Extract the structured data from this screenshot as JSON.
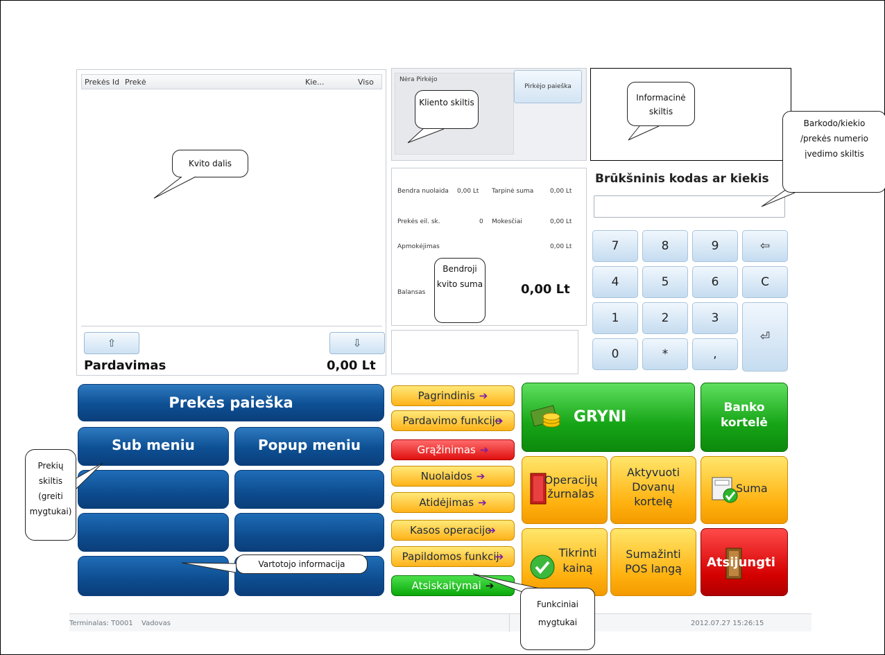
{
  "receipt": {
    "columns": [
      "Prekės Id",
      "Prekė",
      "Kie...",
      "Viso"
    ],
    "scroll_up_icon": "arrow-up-icon",
    "scroll_down_icon": "arrow-down-icon",
    "mode_label": "Pardavimas",
    "total": "0,00 Lt"
  },
  "client": {
    "no_buyer": "Nėra Pirkėjo",
    "search_button": "Pirkėjo paieška"
  },
  "totals": {
    "discount_label": "Bendra nuolaida",
    "discount_value": "0,00 Lt",
    "subtotal_label": "Tarpinė suma",
    "subtotal_value": "0,00 Lt",
    "items_label": "Prekės eil. sk.",
    "items_value": "0",
    "taxes_label": "Mokesčiai",
    "taxes_value": "0,00 Lt",
    "payment_label": "Apmokėjimas",
    "payment_value": "0,00 Lt",
    "balance_label": "Balansas",
    "balance_value": "0,00 Lt"
  },
  "barcode": {
    "title": "Brūkšninis kodas ar kiekis",
    "value": ""
  },
  "keypad": {
    "keys": [
      "7",
      "8",
      "9",
      "⇦",
      "4",
      "5",
      "6",
      "C",
      "1",
      "2",
      "3",
      "0",
      "*",
      ","
    ],
    "enter_icon": "enter-icon"
  },
  "quick": {
    "product_search": "Prekės paieška",
    "sub_menu": "Sub meniu",
    "popup_menu": "Popup meniu"
  },
  "functions": [
    {
      "label": "Pagrindinis",
      "arrow": "➔",
      "color": "yellow"
    },
    {
      "label": "Pardavimo funkcijo",
      "arrow": "➔",
      "color": "yellow"
    },
    {
      "label": "Grąžinimas",
      "arrow": "➔",
      "color": "red"
    },
    {
      "label": "Nuolaidos",
      "arrow": "➔",
      "color": "yellow"
    },
    {
      "label": "Atidėjimas",
      "arrow": "➔",
      "color": "yellow"
    },
    {
      "label": "Kasos operacijo",
      "arrow": "➔",
      "color": "yellow"
    },
    {
      "label": "Papildomos funkcij",
      "arrow": "➔",
      "color": "yellow"
    },
    {
      "label": "Atsiskaitymai",
      "arrow": "➔",
      "color": "green"
    }
  ],
  "actions": {
    "cash": "GRYNI",
    "bank_card": "Banko kortelė",
    "op_journal": "Operacijų žurnalas",
    "activate_gift": "Aktyvuoti Dovanų kortelę",
    "sum": "Suma",
    "check_price": "Tikrinti kainą",
    "minimize": "Sumažinti POS langą",
    "logout": "Atsijungti"
  },
  "status": {
    "terminal": "Terminalas: T0001",
    "user": "Vadovas",
    "datetime": "2012.07.27 15:26:15"
  },
  "callouts": {
    "receipt": "Kvito dalis",
    "client": "Kliento skiltis",
    "info": "Informacinė skiltis",
    "barcode": "Barkodo/kiekio /prekės numerio įvedimo skiltis",
    "total": "Bendroji kvito suma",
    "products": "Prekių skiltis (greiti mygtukai)",
    "user_info": "Vartotojo informacija",
    "functions": "Funkciniai mygtukai"
  },
  "colors": {
    "blue_button": "#0d4f93",
    "yellow_button": "#ffb21a",
    "green_button": "#17a517",
    "red_button": "#d40000",
    "keypad": "#c5dcf0"
  }
}
